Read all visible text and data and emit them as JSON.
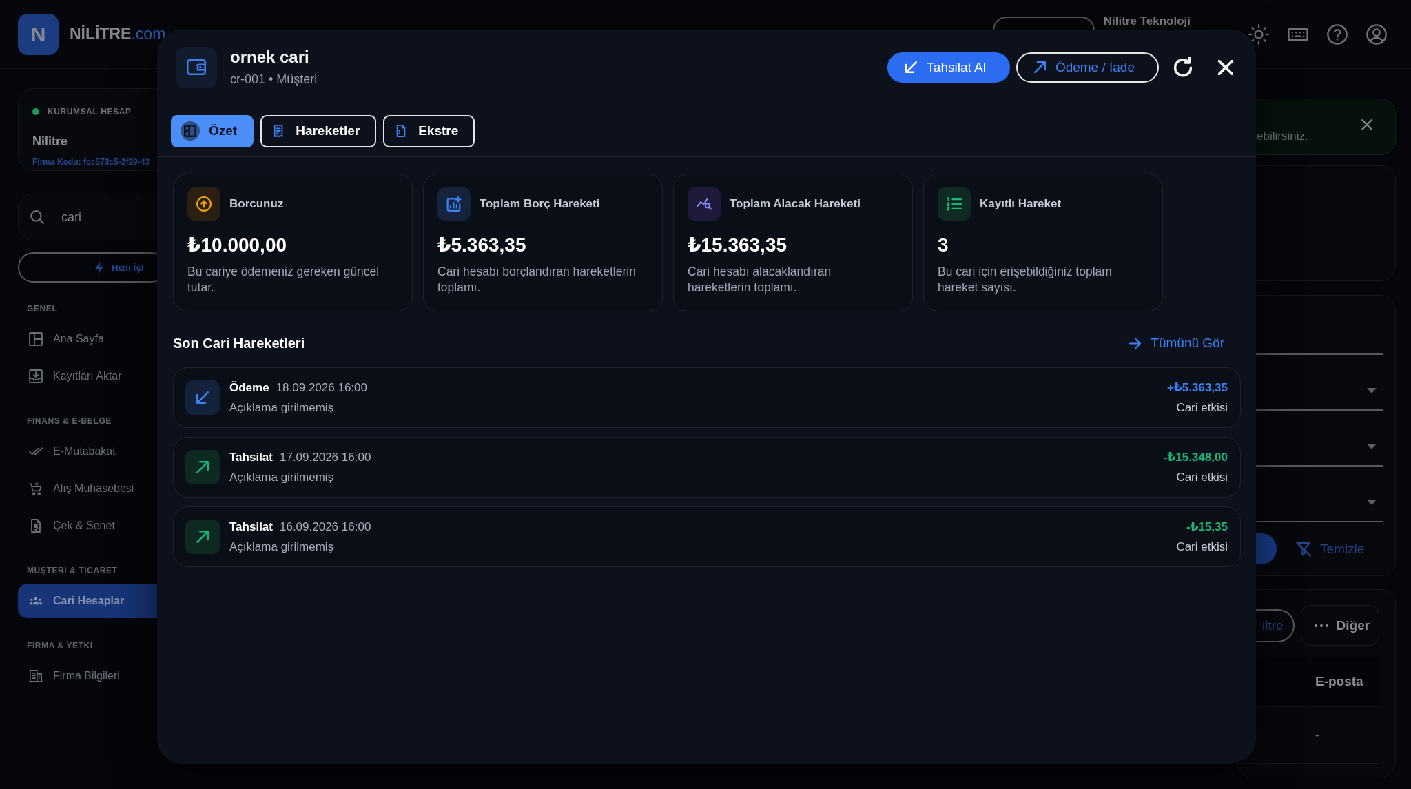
{
  "top_bar": {
    "logo_letter": "N",
    "brand": "NİLİTRE",
    "brand_suffix": ".com",
    "company": "Nilitre Teknoloji"
  },
  "sidebar": {
    "account": {
      "badge": "KURUMSAL HESAP",
      "name": "Nilitre",
      "code": "Firma Kodu: fcc573c5-2f29-43"
    },
    "search": {
      "value": "cari"
    },
    "quick_action": "Hızlı İşl",
    "sections": [
      {
        "title": "GENEL",
        "items": [
          {
            "label": "Ana Sayfa",
            "selected": false
          },
          {
            "label": "Kayıtları Aktar",
            "selected": false
          }
        ]
      },
      {
        "title": "FINANS & E-BELGE",
        "items": [
          {
            "label": "E-Mutabakat",
            "selected": false
          },
          {
            "label": "Alış Muhasebesi",
            "selected": false
          },
          {
            "label": "Çek & Senet",
            "selected": false
          }
        ]
      },
      {
        "title": "MÜŞTERI & TICARET",
        "items": [
          {
            "label": "Cari Hesaplar",
            "selected": true
          }
        ]
      },
      {
        "title": "FIRMA & YETKI",
        "items": [
          {
            "label": "Firma Bilgileri",
            "selected": false
          }
        ]
      }
    ]
  },
  "main": {
    "notice": {
      "text": "ebilirsiniz."
    },
    "filters": {
      "fields": [
        {
          "kind": "text"
        },
        {
          "kind": "select"
        },
        {
          "kind": "select"
        },
        {
          "kind": "select"
        }
      ],
      "clear_button": "Temizle"
    },
    "toolbar": {
      "filter_button": "iltre",
      "more_button": "Diğer"
    },
    "table": {
      "columns": [
        "E-posta"
      ],
      "rows": [
        [
          "-"
        ]
      ]
    }
  },
  "modal": {
    "title": "ornek cari",
    "subtitle": "cr-001 • Müşteri",
    "actions": [
      {
        "kind": "primary",
        "label": "Tahsilat Al"
      },
      {
        "kind": "outline",
        "label": "Ödeme / İade"
      }
    ],
    "tabs": [
      {
        "label": "Özet",
        "selected": true
      },
      {
        "label": "Hareketler",
        "selected": false
      },
      {
        "label": "Ekstre",
        "selected": false
      }
    ],
    "stats": [
      {
        "label": "Borcunuz",
        "value": "₺10.000,00",
        "description": "Bu cariye ödemeniz gereken güncel tutar."
      },
      {
        "label": "Toplam Borç Hareketi",
        "value": "₺5.363,35",
        "description": "Cari hesabı borçlandıran hareketlerin toplamı."
      },
      {
        "label": "Toplam Alacak Hareketi",
        "value": "₺15.363,35",
        "description": "Cari hesabı alacaklandıran hareketlerin toplamı."
      },
      {
        "label": "Kayıtlı Hareket",
        "value": "3",
        "description": "Bu cari için erişebildiğiniz toplam hareket sayısı."
      }
    ],
    "recent": {
      "title": "Son Cari Hareketleri",
      "link": "Tümünü Gör",
      "rows": [
        {
          "kind": "payment",
          "title": "Ödeme",
          "date": "18.09.2026 16:00",
          "note": "Açıklama girilmemiş",
          "amount": "+₺5.363,35",
          "amount_label": "Cari etkisi"
        },
        {
          "kind": "collection",
          "title": "Tahsilat",
          "date": "17.09.2026 16:00",
          "note": "Açıklama girilmemiş",
          "amount": "-₺15.348,00",
          "amount_label": "Cari etkisi"
        },
        {
          "kind": "collection",
          "title": "Tahsilat",
          "date": "16.09.2026 16:00",
          "note": "Açıklama girilmemiş",
          "amount": "-₺15,35",
          "amount_label": "Cari etkisi"
        }
      ]
    }
  }
}
